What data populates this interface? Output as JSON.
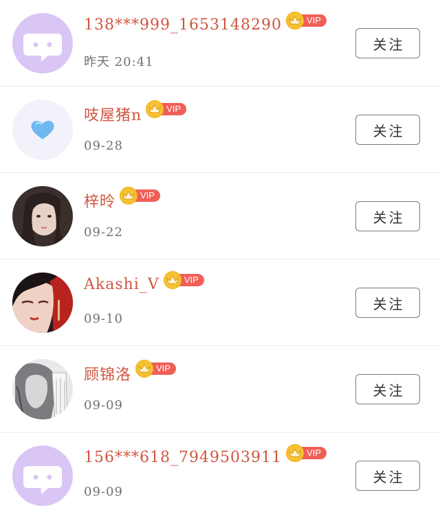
{
  "colors": {
    "name": "#d0553f",
    "vip_badge": "#f05f57",
    "crown": "#f5c233",
    "time": "#707070",
    "default_avatar": "#d9c6f5"
  },
  "vip_label": "VIP",
  "follow_label": "关注",
  "users": [
    {
      "name": "138***999_1653148290",
      "time": "昨天 20:41",
      "avatar": "default-chat-avatar",
      "vip": true
    },
    {
      "name": "吱屋猪n",
      "time": "09-28",
      "avatar": "heart-avatar",
      "vip": true
    },
    {
      "name": "梓昤",
      "time": "09-22",
      "avatar": "photo-avatar",
      "vip": true
    },
    {
      "name": "Akashi_V",
      "time": "09-10",
      "avatar": "illustration-avatar",
      "vip": true
    },
    {
      "name": "顾锦洛",
      "time": "09-09",
      "avatar": "sketch-avatar",
      "vip": true
    },
    {
      "name": "156***618_7949503911",
      "time": "09-09",
      "avatar": "default-chat-avatar",
      "vip": true
    }
  ]
}
